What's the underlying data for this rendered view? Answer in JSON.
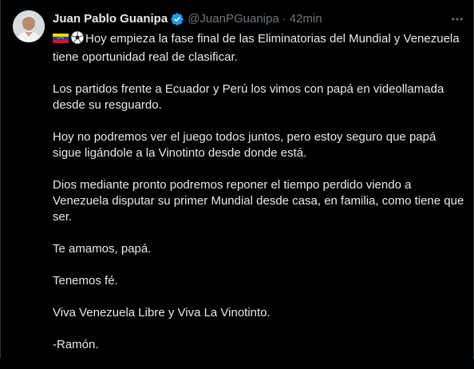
{
  "author": {
    "display_name": "Juan Pablo Guanipa",
    "handle": "@JuanPGuanipa",
    "separator": "·",
    "time": "42min",
    "verified": true
  },
  "icons": {
    "avatar": "profile-photo",
    "verified": "verified-badge-icon",
    "more": "more-options-icon",
    "flag": "venezuela-flag-emoji",
    "ball": "soccer-ball-emoji"
  },
  "colors": {
    "background": "#000000",
    "text": "#e7e9ea",
    "muted": "#71767b",
    "verified": "#1d9bf0"
  },
  "tweet": {
    "first_paragraph": "Hoy empieza la fase final de las Eliminatorias del Mundial y Venezuela tiene oportunidad real de clasificar.",
    "paragraphs": [
      "Los partidos frente a Ecuador y Perú los vimos con papá en videollamada desde su resguardo.",
      "Hoy no podremos ver el juego todos juntos, pero estoy seguro que papá sigue ligándole a la Vinotinto desde donde está.",
      "Dios mediante pronto podremos reponer el tiempo perdido viendo a Venezuela disputar su primer Mundial desde casa, en familia, como tiene que ser.",
      "Te amamos, papá.",
      "Tenemos fé.",
      "Viva Venezuela Libre y Viva La Vinotinto.",
      "-Ramón."
    ]
  }
}
